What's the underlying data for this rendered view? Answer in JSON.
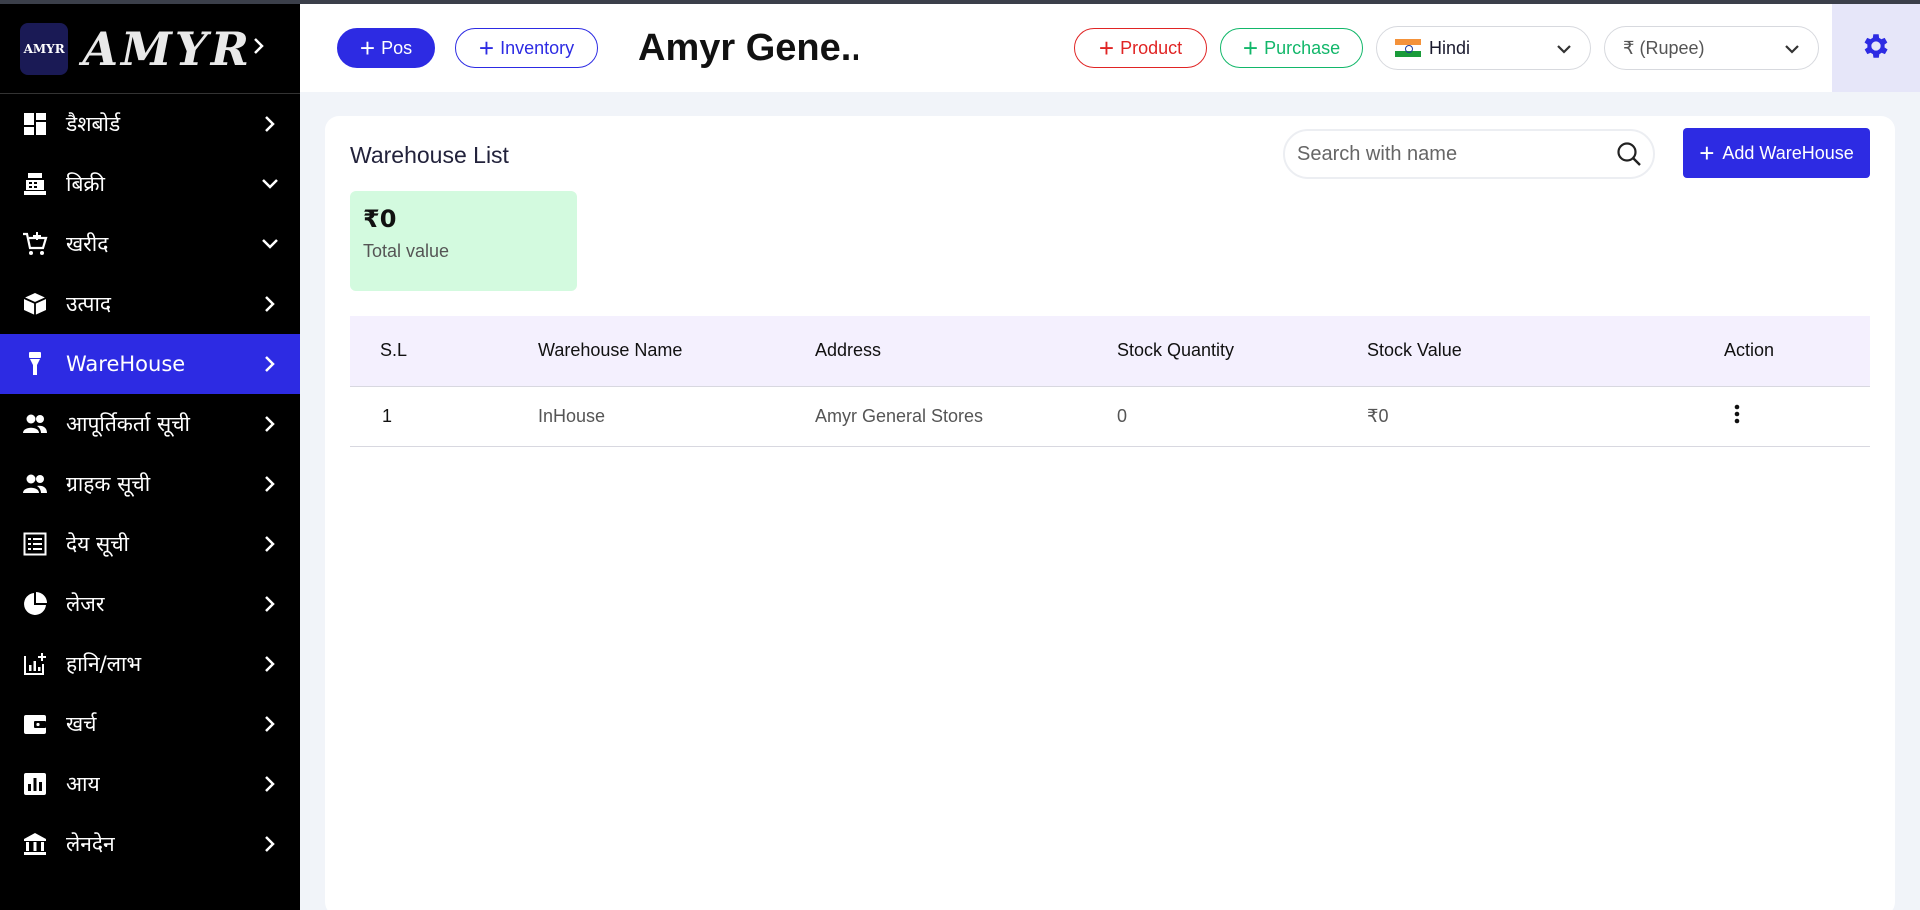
{
  "brand": {
    "logo_text": "AMYR",
    "name": "AMYR"
  },
  "sidebar": {
    "items": [
      {
        "label": "डैशबोर्ड",
        "icon": "dashboard-icon",
        "chevron": "right",
        "active": false
      },
      {
        "label": "बिक्री",
        "icon": "register-icon",
        "chevron": "down",
        "active": false
      },
      {
        "label": "खरीद",
        "icon": "cart-icon",
        "chevron": "down",
        "active": false
      },
      {
        "label": "उत्पाद",
        "icon": "box-icon",
        "chevron": "right",
        "active": false
      },
      {
        "label": "WareHouse",
        "icon": "warehouse-icon",
        "chevron": "right",
        "active": true
      },
      {
        "label": "आपूर्तिकर्ता सूची",
        "icon": "people-icon",
        "chevron": "right",
        "active": false
      },
      {
        "label": "ग्राहक सूची",
        "icon": "people-icon",
        "chevron": "right",
        "active": false
      },
      {
        "label": "देय सूची",
        "icon": "list-icon",
        "chevron": "right",
        "active": false
      },
      {
        "label": "लेजर",
        "icon": "pie-icon",
        "chevron": "right",
        "active": false
      },
      {
        "label": "हानि/लाभ",
        "icon": "analytics-icon",
        "chevron": "right",
        "active": false
      },
      {
        "label": "खर्च",
        "icon": "wallet-icon",
        "chevron": "right",
        "active": false
      },
      {
        "label": "आय",
        "icon": "bar-chart-icon",
        "chevron": "right",
        "active": false
      },
      {
        "label": "लेनदेन",
        "icon": "bank-icon",
        "chevron": "right",
        "active": false
      }
    ]
  },
  "header": {
    "pos_label": "Pos",
    "inventory_label": "Inventory",
    "company": "Amyr Gene...",
    "product_label": "Product",
    "purchase_label": "Purchase",
    "language": "Hindi",
    "currency": "₹ (Rupee)"
  },
  "main": {
    "title": "Warehouse List",
    "search_placeholder": "Search with name",
    "add_label": "Add WareHouse",
    "total_value": "₹0",
    "total_label": "Total value",
    "table": {
      "columns": [
        "S.L",
        "Warehouse Name",
        "Address",
        "Stock Quantity",
        "Stock Value",
        "Action"
      ],
      "rows": [
        {
          "sl": "1",
          "name": "InHouse",
          "address": "Amyr General Stores",
          "qty": "0",
          "value": "₹0"
        }
      ]
    }
  },
  "colors": {
    "accent": "#2d2be3",
    "product": "#e02424",
    "purchase": "#12b76a",
    "total_bg": "#d3fadf"
  }
}
